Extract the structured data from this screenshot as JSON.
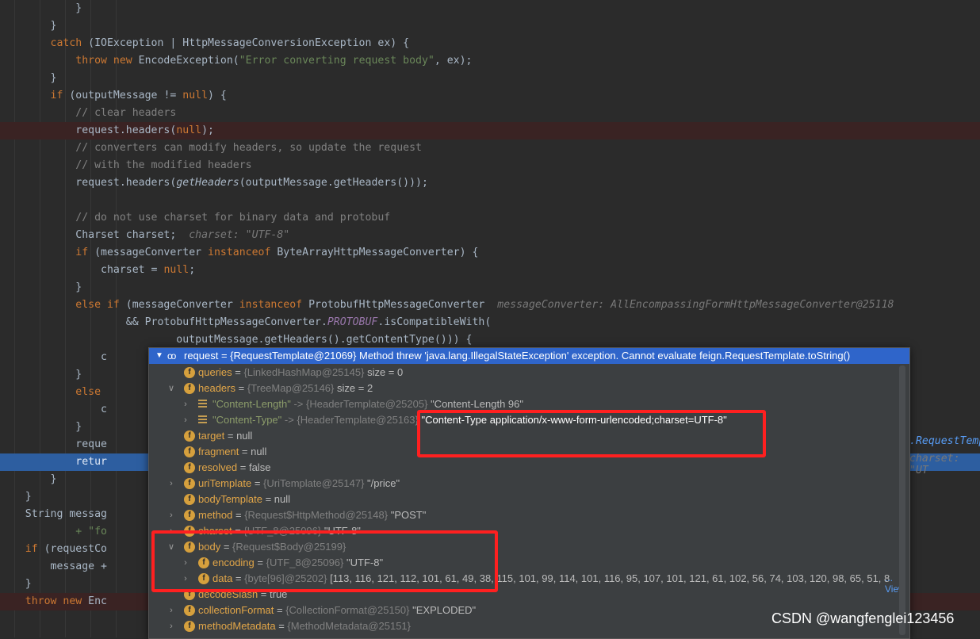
{
  "code_lines": [
    {
      "t": [
        [
          "txt",
          "            }"
        ]
      ]
    },
    {
      "t": [
        [
          "txt",
          "        }"
        ]
      ]
    },
    {
      "t": [
        [
          "k",
          "        catch"
        ],
        [
          "txt",
          " (IOException | HttpMessageConversionException ex) {"
        ]
      ]
    },
    {
      "t": [
        [
          "k",
          "            throw new"
        ],
        [
          "txt",
          " EncodeException("
        ],
        [
          "s",
          "\"Error converting request body\""
        ],
        [
          "txt",
          ", ex);"
        ]
      ]
    },
    {
      "t": [
        [
          "txt",
          "        }"
        ]
      ]
    },
    {
      "t": [
        [
          "k",
          "        if"
        ],
        [
          "txt",
          " (outputMessage != "
        ],
        [
          "k",
          "null"
        ],
        [
          "txt",
          ") {"
        ]
      ]
    },
    {
      "t": [
        [
          "cm",
          "            // clear headers"
        ]
      ]
    },
    {
      "cls": "err",
      "t": [
        [
          "txt",
          "            request.headers("
        ],
        [
          "k",
          "null"
        ],
        [
          "txt",
          ");"
        ]
      ]
    },
    {
      "t": [
        [
          "cm",
          "            // converters can modify headers, so update the request"
        ]
      ]
    },
    {
      "t": [
        [
          "cm",
          "            // with the modified headers"
        ]
      ]
    },
    {
      "t": [
        [
          "txt",
          "            request.headers("
        ],
        [
          "fn",
          "getHeaders"
        ],
        [
          "txt",
          "(outputMessage.getHeaders()));"
        ]
      ]
    },
    {
      "t": [
        [
          "txt",
          ""
        ]
      ]
    },
    {
      "t": [
        [
          "cm",
          "            // do not use charset for binary data and protobuf"
        ]
      ]
    },
    {
      "t": [
        [
          "txt",
          "            Charset charset;  "
        ],
        [
          "hint",
          "charset: \"UTF-8\""
        ]
      ]
    },
    {
      "t": [
        [
          "k",
          "            if"
        ],
        [
          "txt",
          " (messageConverter "
        ],
        [
          "k",
          "instanceof"
        ],
        [
          "txt",
          " ByteArrayHttpMessageConverter) {"
        ]
      ]
    },
    {
      "t": [
        [
          "txt",
          "                charset = "
        ],
        [
          "k",
          "null"
        ],
        [
          "txt",
          ";"
        ]
      ]
    },
    {
      "t": [
        [
          "txt",
          "            }"
        ]
      ]
    },
    {
      "t": [
        [
          "k",
          "            else if"
        ],
        [
          "txt",
          " (messageConverter "
        ],
        [
          "k",
          "instanceof"
        ],
        [
          "txt",
          " ProtobufHttpMessageConverter  "
        ],
        [
          "hint",
          "messageConverter: AllEncompassingFormHttpMessageConverter@25118"
        ]
      ]
    },
    {
      "t": [
        [
          "txt",
          "                    && ProtobufHttpMessageConverter."
        ],
        [
          "cst",
          "PROTOBUF"
        ],
        [
          "txt",
          ".isCompatibleWith("
        ]
      ]
    },
    {
      "t": [
        [
          "txt",
          "                            outputMessage.getHeaders().getContentType())) {"
        ]
      ]
    },
    {
      "t": [
        [
          "txt",
          "                c"
        ]
      ]
    },
    {
      "t": [
        [
          "txt",
          "            }"
        ]
      ]
    },
    {
      "t": [
        [
          "k",
          "            else"
        ]
      ]
    },
    {
      "t": [
        [
          "txt",
          "                c"
        ]
      ]
    },
    {
      "t": [
        [
          "txt",
          "            }"
        ]
      ]
    },
    {
      "t": [
        [
          "txt",
          "            reque"
        ]
      ]
    },
    {
      "cls": "exec",
      "t": [
        [
          "k",
          "            retur"
        ]
      ]
    },
    {
      "t": [
        [
          "txt",
          "        }"
        ]
      ]
    },
    {
      "t": [
        [
          "txt",
          "    }"
        ]
      ]
    },
    {
      "t": [
        [
          "txt",
          "    String messag"
        ]
      ]
    },
    {
      "t": [
        [
          "s",
          "            + \"fo"
        ]
      ]
    },
    {
      "t": [
        [
          "k",
          "    if"
        ],
        [
          "txt",
          " (requestCo"
        ]
      ]
    },
    {
      "t": [
        [
          "txt",
          "        message +"
        ]
      ]
    },
    {
      "t": [
        [
          "txt",
          "    }"
        ]
      ]
    },
    {
      "cls": "err",
      "t": [
        [
          "k",
          "    throw new"
        ],
        [
          "txt",
          " Enc"
        ]
      ]
    }
  ],
  "right_fragments": {
    "request_temp": ".RequestTemp",
    "charset_hint": "charset: \"UT"
  },
  "popup": {
    "header": "request = {RequestTemplate@21069} Method threw 'java.lang.IllegalStateException' exception. Cannot evaluate feign.RequestTemplate.toString()",
    "rows": [
      {
        "indent": 1,
        "tw": "",
        "icon": "f",
        "name": "queries",
        "ref": "{LinkedHashMap@25145}",
        "val": " size = 0"
      },
      {
        "indent": 1,
        "tw": "v",
        "icon": "f",
        "name": "headers",
        "ref": "{TreeMap@25146}",
        "val": " size = 2"
      },
      {
        "indent": 2,
        "tw": ">",
        "icon": "m",
        "key": "\"Content-Length\"",
        "ref": "{HeaderTemplate@25205}",
        "val": "\"Content-Length 96\""
      },
      {
        "indent": 2,
        "tw": ">",
        "icon": "m",
        "key": "\"Content-Type\"",
        "ref": "{HeaderTemplate@25163}",
        "val": "\"Content-Type application/x-www-form-urlencoded;charset=UTF-8\""
      },
      {
        "indent": 1,
        "tw": "",
        "icon": "f",
        "name": "target",
        "ref": "",
        "val": "null"
      },
      {
        "indent": 1,
        "tw": "",
        "icon": "f",
        "name": "fragment",
        "ref": "",
        "val": "null"
      },
      {
        "indent": 1,
        "tw": "",
        "icon": "f",
        "name": "resolved",
        "ref": "",
        "val": "false"
      },
      {
        "indent": 1,
        "tw": ">",
        "icon": "f",
        "name": "uriTemplate",
        "ref": "{UriTemplate@25147}",
        "val": "\"/price\""
      },
      {
        "indent": 1,
        "tw": "",
        "icon": "f",
        "name": "bodyTemplate",
        "ref": "",
        "val": "null"
      },
      {
        "indent": 1,
        "tw": ">",
        "icon": "f",
        "name": "method",
        "ref": "{Request$HttpMethod@25148}",
        "val": "\"POST\""
      },
      {
        "indent": 1,
        "tw": ">",
        "icon": "f",
        "name": "charset",
        "ref": "{UTF_8@25096}",
        "val": "\"UTF-8\""
      },
      {
        "indent": 1,
        "tw": "v",
        "icon": "f",
        "name": "body",
        "ref": "{Request$Body@25199}",
        "val": ""
      },
      {
        "indent": 2,
        "tw": ">",
        "icon": "f",
        "name": "encoding",
        "ref": "{UTF_8@25096}",
        "val": "\"UTF-8\""
      },
      {
        "indent": 2,
        "tw": ">",
        "icon": "f",
        "name": "data",
        "ref": "{byte[96]@25202}",
        "val": "[113, 116, 121, 112, 101, 61, 49, 38, 115, 101, 99, 114, 101, 116, 95, 107, 101, 121, 61, 102, 56, 74, 103, 120, 98, 65, 51, 8"
      },
      {
        "indent": 1,
        "tw": "",
        "icon": "f",
        "name": "decodeSlash",
        "ref": "",
        "val": "true"
      },
      {
        "indent": 1,
        "tw": ">",
        "icon": "f",
        "name": "collectionFormat",
        "ref": "{CollectionFormat@25150}",
        "val": "\"EXPLODED\""
      },
      {
        "indent": 1,
        "tw": ">",
        "icon": "f",
        "name": "methodMetadata",
        "ref": "{MethodMetadata@25151}",
        "val": ""
      }
    ],
    "view_link": "... View"
  },
  "watermark": "CSDN @wangfenglei123456",
  "colors": {
    "highlight_box": "#ff2020",
    "exec_line": "#2d5ea0",
    "popup_header": "#2f65ca"
  }
}
